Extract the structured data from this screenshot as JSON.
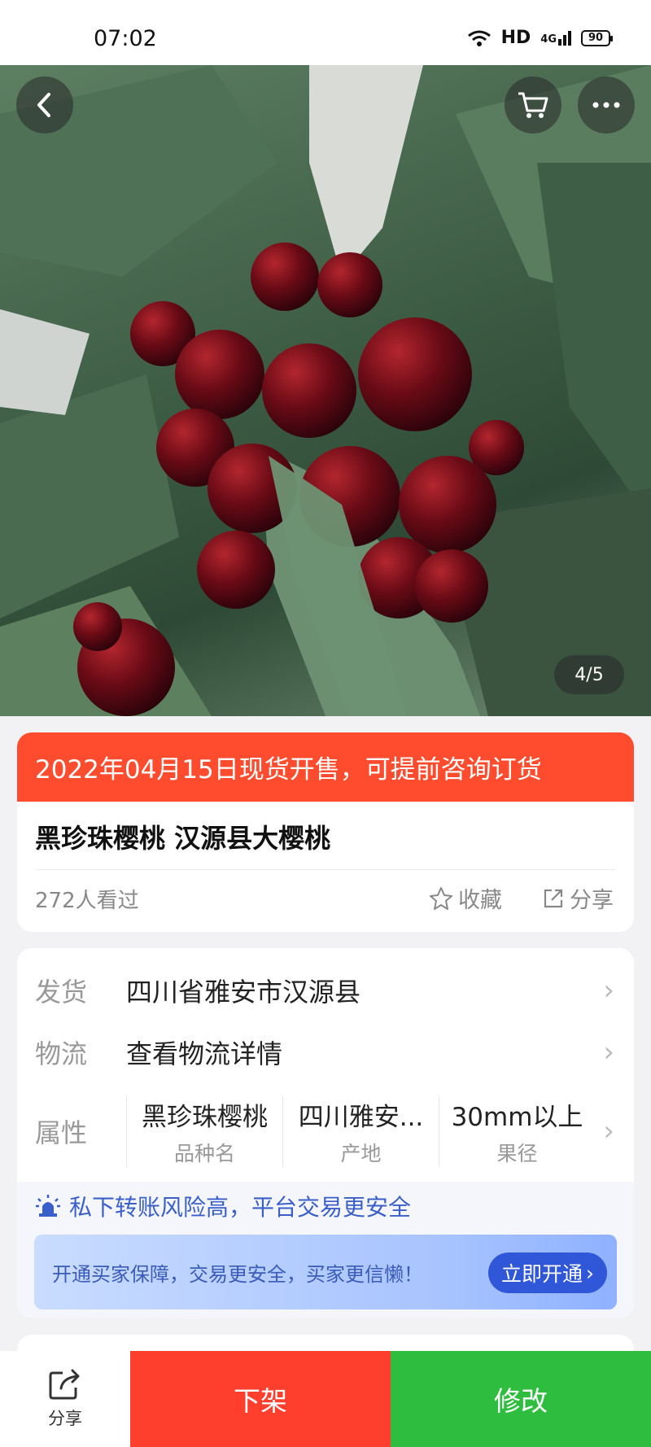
{
  "status_bar": {
    "time": "07:02",
    "network": "HD",
    "signal": "4G",
    "battery": "90"
  },
  "photo": {
    "counter": "4/5"
  },
  "product": {
    "banner": "2022年04月15日现货开售，可提前咨询订货",
    "title": "黑珍珠樱桃 汉源县大樱桃",
    "views": "272人看过",
    "favorite_label": "收藏",
    "share_label": "分享"
  },
  "details": {
    "shipping": {
      "label": "发货",
      "value": "四川省雅安市汉源县"
    },
    "logistics": {
      "label": "物流",
      "value": "查看物流详情"
    },
    "attributes": {
      "label": "属性",
      "items": [
        {
          "value": "黑珍珠樱桃",
          "key": "品种名"
        },
        {
          "value": "四川雅安...",
          "key": "产地"
        },
        {
          "value": "30mm以上",
          "key": "果径"
        }
      ]
    }
  },
  "safety": {
    "warning": "私下转账风险高，平台交易更安全",
    "promo_text": "开通买家保障，交易更安全，买家更信懒！",
    "promo_button": "立即开通"
  },
  "bottom_bar": {
    "share": "分享",
    "delist": "下架",
    "edit": "修改"
  },
  "colors": {
    "accent_red": "#ff3f2e",
    "accent_green": "#2fbd3f",
    "banner_red": "#ff4c2e",
    "link_blue": "#3a5fc8"
  }
}
